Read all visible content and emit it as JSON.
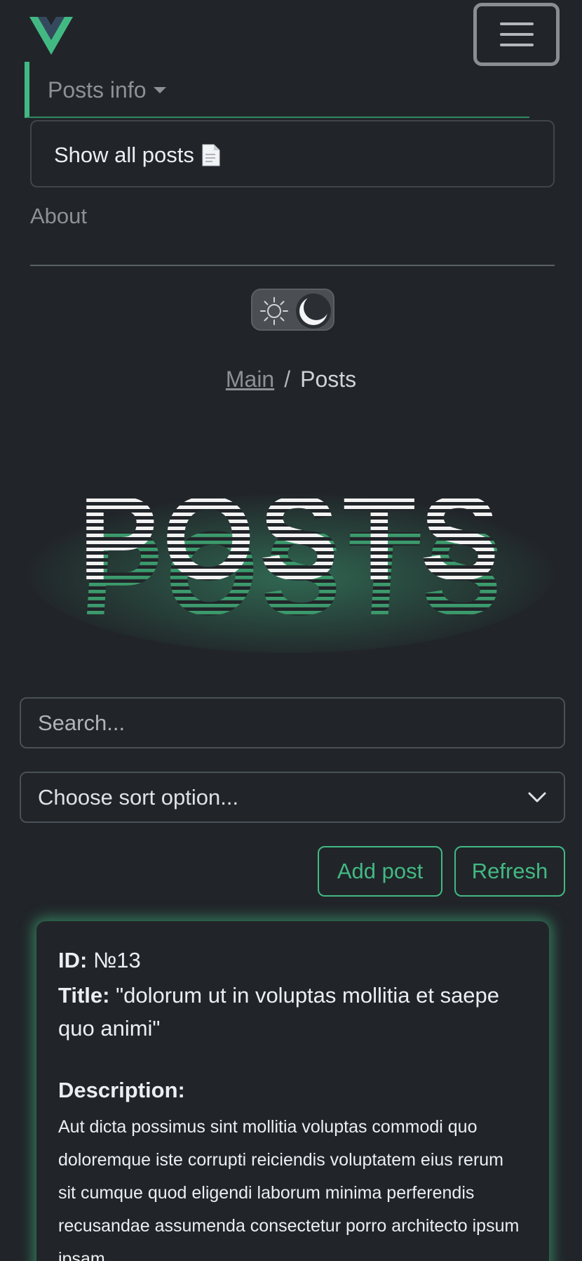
{
  "navbar": {
    "logo_icon": "vue-logo-icon",
    "toggler_icon": "hamburger-icon",
    "posts_dropdown_label": "Posts info",
    "dropdown_item_label": "Show all posts",
    "dropdown_item_icon": "document-icon",
    "about_label": "About"
  },
  "theme_switch": {
    "light_icon": "sun-icon",
    "dark_icon": "moon-icon",
    "selected": "dark"
  },
  "breadcrumb": {
    "main": "Main",
    "separator": "/",
    "current": "Posts"
  },
  "hero_title": "POSTS",
  "search": {
    "placeholder": "Search...",
    "value": ""
  },
  "sort": {
    "selected": "Choose sort option..."
  },
  "actions": {
    "add_label": "Add post",
    "refresh_label": "Refresh"
  },
  "post": {
    "id_label": "ID:",
    "id_value": "№13",
    "title_label": "Title:",
    "title_value": "\"dolorum ut in voluptas mollitia et saepe quo animi\"",
    "description_label": "Description:",
    "description_value": "Aut dicta possimus sint mollitia voluptas commodi quo doloremque iste corrupti reiciendis voluptatem eius rerum sit cumque quod eligendi laborum minima perferendis recusandae assumenda consectetur porro architecto ipsum ipsam"
  },
  "colors": {
    "accent": "#42b983",
    "background": "#212529"
  }
}
